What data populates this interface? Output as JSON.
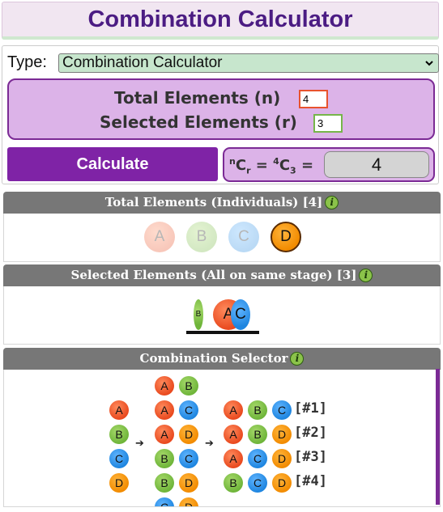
{
  "title": "Combination Calculator",
  "type_label": "Type:",
  "type_value": "Combination Calculator",
  "total_label": "Total Elements (n)",
  "total_value": "4",
  "selected_label": "Selected Elements (r)",
  "selected_value": "3",
  "calculate_label": "Calculate",
  "formula": {
    "n_sup": "n",
    "c": "C",
    "r_sub": "r",
    "eq": "=",
    "four_sup": "4",
    "c2": "C",
    "three_sub": "3",
    "eq2": "="
  },
  "result": "4",
  "sections": {
    "total": "Total Elements (Individuals) [4]",
    "selected": "Selected Elements (All on same stage) [3]",
    "selector": "Combination Selector"
  },
  "info_glyph": "i",
  "total_balls": [
    "A",
    "B",
    "C",
    "D"
  ],
  "stage": {
    "left": "B",
    "mid": "A",
    "right": "C"
  },
  "selector": {
    "col1": [
      "A",
      "B",
      "C",
      "D"
    ],
    "col2": [
      [
        "A",
        "B"
      ],
      [
        "A",
        "C"
      ],
      [
        "A",
        "D"
      ],
      [
        "B",
        "C"
      ],
      [
        "B",
        "D"
      ],
      [
        "C",
        "D"
      ]
    ],
    "col3": [
      [
        "A",
        "B",
        "C"
      ],
      [
        "A",
        "B",
        "D"
      ],
      [
        "A",
        "C",
        "D"
      ],
      [
        "B",
        "C",
        "D"
      ]
    ],
    "labels": [
      "[#1]",
      "[#2]",
      "[#3]",
      "[#4]"
    ],
    "arrow": "➔"
  },
  "colors": {
    "A": "#e94a1f",
    "B": "#6fb53a",
    "C": "#1f86e0",
    "D": "#f28b00",
    "accent": "#7f23a6",
    "title": "#4b1c83"
  }
}
